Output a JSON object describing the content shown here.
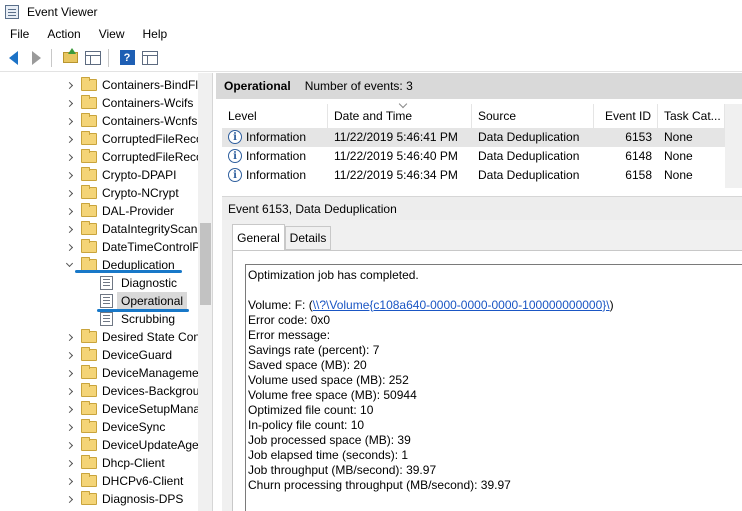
{
  "window": {
    "title": "Event Viewer"
  },
  "menu": [
    "File",
    "Action",
    "View",
    "Help"
  ],
  "toolbar": {
    "help_glyph": "?"
  },
  "tree": {
    "items": [
      {
        "label": "Containers-BindFl",
        "type": "folder",
        "expanded": false
      },
      {
        "label": "Containers-Wcifs",
        "type": "folder",
        "expanded": false
      },
      {
        "label": "Containers-Wcnfs",
        "type": "folder",
        "expanded": false
      },
      {
        "label": "CorruptedFileReco",
        "type": "folder",
        "expanded": false
      },
      {
        "label": "CorruptedFileReco",
        "type": "folder",
        "expanded": false
      },
      {
        "label": "Crypto-DPAPI",
        "type": "folder",
        "expanded": false
      },
      {
        "label": "Crypto-NCrypt",
        "type": "folder",
        "expanded": false
      },
      {
        "label": "DAL-Provider",
        "type": "folder",
        "expanded": false
      },
      {
        "label": "DataIntegrityScan",
        "type": "folder",
        "expanded": false
      },
      {
        "label": "DateTimeControlP",
        "type": "folder",
        "expanded": false
      },
      {
        "label": "Deduplication",
        "type": "folder",
        "expanded": true
      },
      {
        "label": "Diagnostic",
        "type": "log"
      },
      {
        "label": "Operational",
        "type": "log",
        "selected": true
      },
      {
        "label": "Scrubbing",
        "type": "log"
      },
      {
        "label": "Desired State Con",
        "type": "folder",
        "expanded": false
      },
      {
        "label": "DeviceGuard",
        "type": "folder",
        "expanded": false
      },
      {
        "label": "DeviceManageme",
        "type": "folder",
        "expanded": false
      },
      {
        "label": "Devices-Backgrou",
        "type": "folder",
        "expanded": false
      },
      {
        "label": "DeviceSetupMana",
        "type": "folder",
        "expanded": false
      },
      {
        "label": "DeviceSync",
        "type": "folder",
        "expanded": false
      },
      {
        "label": "DeviceUpdateAge",
        "type": "folder",
        "expanded": false
      },
      {
        "label": "Dhcp-Client",
        "type": "folder",
        "expanded": false
      },
      {
        "label": "DHCPv6-Client",
        "type": "folder",
        "expanded": false
      },
      {
        "label": "Diagnosis-DPS",
        "type": "folder",
        "expanded": false
      }
    ]
  },
  "log_header": {
    "title": "Operational",
    "count": "Number of events: 3"
  },
  "events_table": {
    "columns": [
      "Level",
      "Date and Time",
      "Source",
      "Event ID",
      "Task Cat..."
    ],
    "rows": [
      {
        "level": "Information",
        "datetime": "11/22/2019 5:46:41 PM",
        "source": "Data Deduplication",
        "event_id": "6153",
        "task": "None",
        "selected": true
      },
      {
        "level": "Information",
        "datetime": "11/22/2019 5:46:40 PM",
        "source": "Data Deduplication",
        "event_id": "6148",
        "task": "None"
      },
      {
        "level": "Information",
        "datetime": "11/22/2019 5:46:34 PM",
        "source": "Data Deduplication",
        "event_id": "6158",
        "task": "None"
      }
    ]
  },
  "detail": {
    "header": "Event 6153, Data Deduplication",
    "tabs": [
      "General",
      "Details"
    ],
    "summary": "Optimization job has completed.",
    "volume_label": "Volume: F: (",
    "volume_link": "\\\\?\\Volume{c108a640-0000-0000-0000-100000000000}\\",
    "volume_close": ")",
    "lines": [
      "Error code: 0x0",
      "Error message:",
      "Savings rate (percent): 7",
      "Saved space (MB): 20",
      "Volume used space (MB): 252",
      "Volume free space (MB): 50944",
      "Optimized file count: 10",
      "In-policy file count: 10",
      "Job processed space (MB): 39",
      "Job elapsed time (seconds): 1",
      "Job throughput (MB/second): 39.97",
      "Churn processing throughput (MB/second): 39.97"
    ]
  },
  "colors": {
    "accent_underline": "#1878c8",
    "link": "#1a56c4",
    "selection": "#d9d9d9"
  }
}
